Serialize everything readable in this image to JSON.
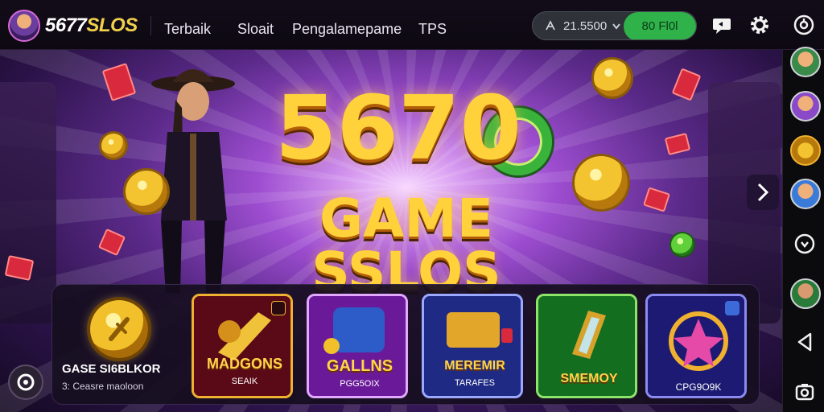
{
  "header": {
    "brand_prefix": "5677",
    "brand_suffix": "SLOS",
    "nav": [
      "Terbaik",
      "Sloait",
      "Pengalamepame",
      "TPS"
    ],
    "balance": "21.5500",
    "deposit_label": "80 Fl0l",
    "icons": [
      "user-avatar",
      "coin-icon",
      "chevron-down-icon",
      "chat-icon",
      "gear-icon",
      "power-icon"
    ]
  },
  "hero": {
    "title": "5670",
    "subtitle": "GAME SSLOS"
  },
  "featured": {
    "title": "GASE SI6BLKOR",
    "subtitle": "3: Ceasre maoloon"
  },
  "games": [
    {
      "name": "MADGONS",
      "sub": "SEAIK",
      "colors": [
        "#8e1224",
        "#4a0610",
        "#f0b030"
      ]
    },
    {
      "name": "GALLNS",
      "sub": "PGG5OIX",
      "colors": [
        "#a83ad8",
        "#5a1488",
        "#e2a8ff"
      ]
    },
    {
      "name": "MEREMIR",
      "sub": "TARAFES",
      "colors": [
        "#3c4cc8",
        "#1a2468",
        "#9aa8ff"
      ]
    },
    {
      "name": "SMEMOY",
      "sub": "",
      "colors": [
        "#1f8e2c",
        "#0b4212",
        "#8ee36a"
      ]
    },
    {
      "name": "",
      "sub": "CPG9O9K",
      "colors": [
        "#3a38b8",
        "#16145c",
        "#f0b030"
      ]
    }
  ],
  "rail": {
    "avatars": [
      "player-1",
      "player-2",
      "chest",
      "player-3",
      "player-4"
    ],
    "icons": [
      "compass-icon",
      "chevron-circle-icon",
      "back-triangle-icon",
      "screenshot-icon"
    ]
  },
  "colors": {
    "gold": "#ffd23c",
    "green": "#2fb24a",
    "purple": "#9d4dd0"
  }
}
